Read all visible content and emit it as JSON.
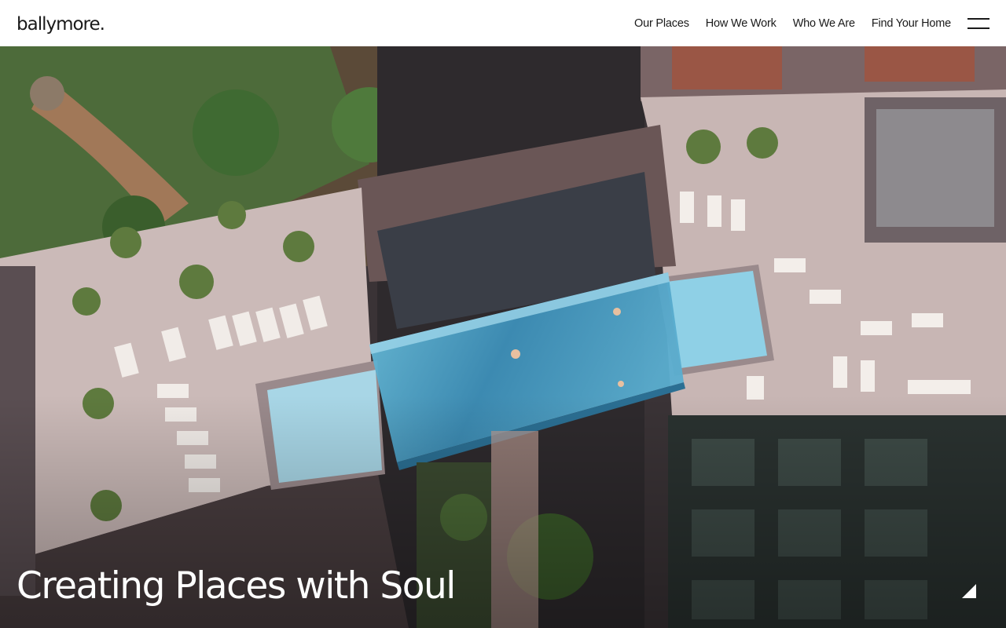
{
  "header": {
    "logo": "ballymore.",
    "nav": [
      {
        "label": "Our Places"
      },
      {
        "label": "How We Work"
      },
      {
        "label": "Who We Are"
      },
      {
        "label": "Find Your Home"
      }
    ],
    "menu_icon": "hamburger-menu-icon"
  },
  "hero": {
    "title": "Creating Places with Soul",
    "image_description_icon": "aerial-sky-pool-image",
    "corner_icon": "triangle-corner-icon"
  },
  "colors": {
    "header_bg": "#ffffff",
    "text_dark": "#1a1a1a",
    "hero_text": "#ffffff",
    "pool_water": "#4a9fc4",
    "deck": "#c9b8b6"
  }
}
